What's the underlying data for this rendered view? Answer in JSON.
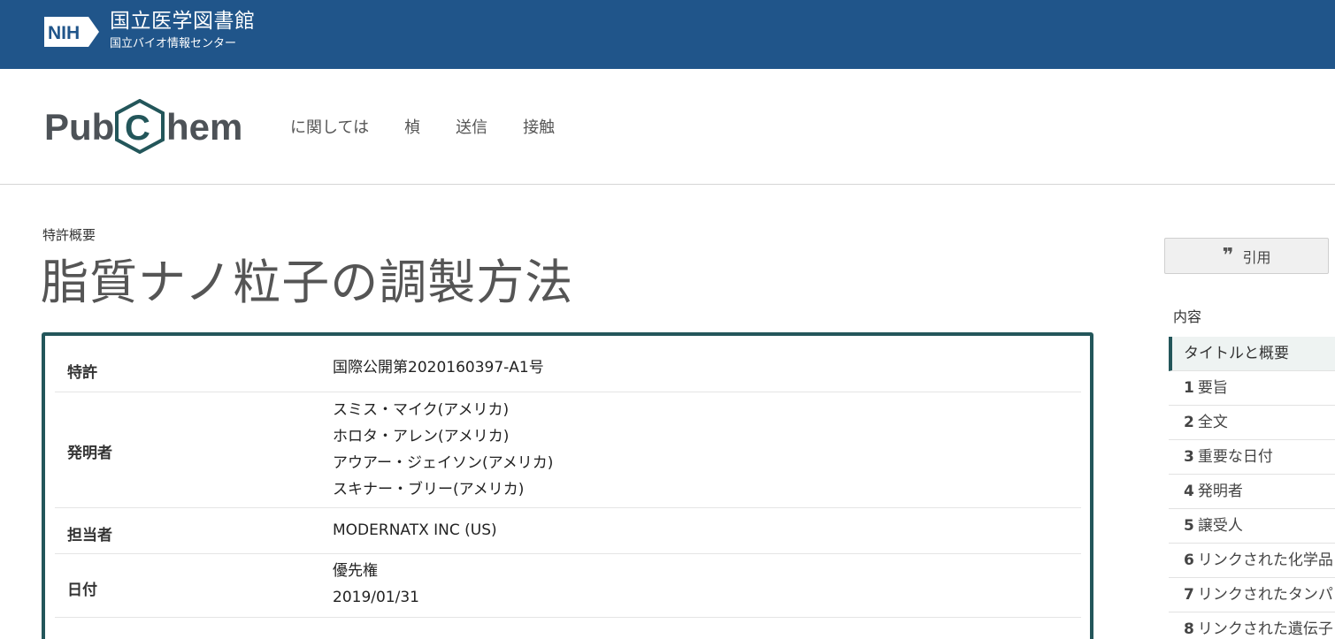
{
  "nih": {
    "logo_text": "NIH",
    "title": "国立医学図書館",
    "subtitle": "国立バイオ情報センター"
  },
  "pubchem": {
    "logo_text": "PubChem",
    "nav": [
      "に関しては",
      "楨",
      "送信",
      "接触"
    ]
  },
  "page": {
    "kicker": "特許概要",
    "title": "脂質ナノ粒子の調製方法"
  },
  "summary": {
    "patent_label": "特許",
    "patent_value": "国際公開第2020160397-A1号",
    "inventors_label": "発明者",
    "inventors": [
      "スミス・マイク(アメリカ)",
      "ホロタ・アレン(アメリカ)",
      "アウアー・ジェイソン(アメリカ)",
      "スキナー・ブリー(アメリカ)"
    ],
    "assignee_label": "担当者",
    "assignee_value": "MODERNATX INC (US)",
    "dates_label": "日付",
    "dates_priority_label": "優先権",
    "dates_priority_value": "2019/01/31"
  },
  "sidebar": {
    "cite_label": "引用",
    "cite_icon": "quote-icon",
    "toc_heading": "内容",
    "toc": [
      {
        "num": "",
        "label": "タイトルと概要"
      },
      {
        "num": "1",
        "label": "要旨"
      },
      {
        "num": "2",
        "label": "全文"
      },
      {
        "num": "3",
        "label": "重要な日付"
      },
      {
        "num": "4",
        "label": "発明者"
      },
      {
        "num": "5",
        "label": "譲受人"
      },
      {
        "num": "6",
        "label": "リンクされた化学品"
      },
      {
        "num": "7",
        "label": "リンクされたタンパ"
      },
      {
        "num": "8",
        "label": "リンクされた遺伝子"
      }
    ]
  },
  "colors": {
    "nih_blue": "#20558a",
    "pubchem_teal": "#23565a"
  }
}
